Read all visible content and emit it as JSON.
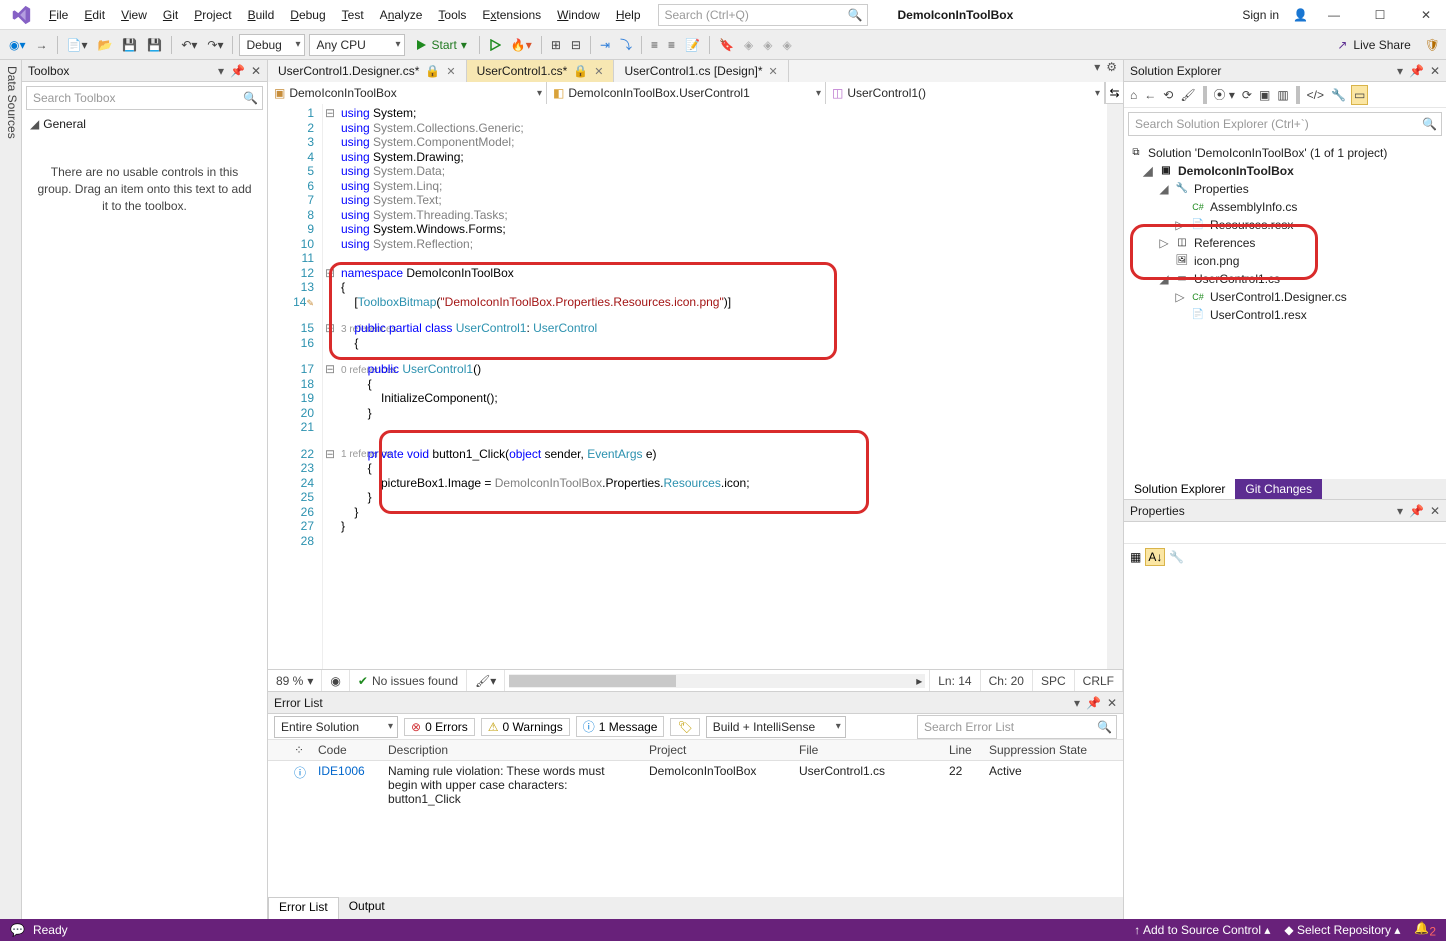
{
  "titlebar": {
    "menus": [
      "File",
      "Edit",
      "View",
      "Git",
      "Project",
      "Build",
      "Debug",
      "Test",
      "Analyze",
      "Tools",
      "Extensions",
      "Window",
      "Help"
    ],
    "menuKeys": [
      "F",
      "E",
      "V",
      "G",
      "P",
      "B",
      "D",
      "T",
      "n",
      "T",
      "x",
      "W",
      "H"
    ],
    "searchPlaceholder": "Search (Ctrl+Q)",
    "projectName": "DemoIconInToolBox",
    "signIn": "Sign in"
  },
  "toolbar": {
    "config": "Debug",
    "platform": "Any CPU",
    "start": "Start",
    "liveShare": "Live Share"
  },
  "leftRail": "Data Sources",
  "toolbox": {
    "title": "Toolbox",
    "searchPlaceholder": "Search Toolbox",
    "group": "General",
    "emptyMsg": "There are no usable controls in this group. Drag an item onto this text to add it to the toolbox."
  },
  "tabs": [
    {
      "label": "UserControl1.Designer.cs*",
      "active": false,
      "lock": true
    },
    {
      "label": "UserControl1.cs*",
      "active": true,
      "lock": true
    },
    {
      "label": "UserControl1.cs [Design]*",
      "active": false,
      "lock": false
    }
  ],
  "navbar": {
    "project": "DemoIconInToolBox",
    "class": "DemoIconInToolBox.UserControl1",
    "member": "UserControl1()"
  },
  "code": {
    "lines": [
      {
        "n": 1,
        "html": "<span class='kw'>using</span> System;"
      },
      {
        "n": 2,
        "html": "<span class='kw'>using</span> <span class='faded'>System.Collections.Generic;</span>"
      },
      {
        "n": 3,
        "html": "<span class='kw'>using</span> <span class='faded'>System.ComponentModel;</span>"
      },
      {
        "n": 4,
        "html": "<span class='kw'>using</span> System.Drawing;"
      },
      {
        "n": 5,
        "html": "<span class='kw'>using</span> <span class='faded'>System.Data;</span>"
      },
      {
        "n": 6,
        "html": "<span class='kw'>using</span> <span class='faded'>System.Linq;</span>"
      },
      {
        "n": 7,
        "html": "<span class='kw'>using</span> <span class='faded'>System.Text;</span>"
      },
      {
        "n": 8,
        "html": "<span class='kw'>using</span> <span class='faded'>System.Threading.Tasks;</span>"
      },
      {
        "n": 9,
        "html": "<span class='kw'>using</span> System.Windows.Forms;"
      },
      {
        "n": 10,
        "html": "<span class='kw'>using</span> <span class='faded'>System.Reflection;</span>"
      },
      {
        "n": 11,
        "html": ""
      },
      {
        "n": 12,
        "html": "<span class='kw'>namespace</span> DemoIconInToolBox"
      },
      {
        "n": 13,
        "html": "{"
      },
      {
        "n": "",
        "html": "    [<span class='typ'>ToolboxBitmap</span>(<span class='str'>\"DemoIconInToolBox.Properties.Resources.icon.png\"</span>)]",
        "pre14": true
      },
      {
        "n": "",
        "html": "     <span class='ref'>3 references</span>",
        "ref": true
      },
      {
        "n": 15,
        "html": "    <span class='kw'>public</span> <span class='kw'>partial</span> <span class='kw'>class</span> <span class='typ'>UserControl1</span>: <span class='typ'>UserControl</span>"
      },
      {
        "n": 16,
        "html": "    {"
      },
      {
        "n": "",
        "html": "         <span class='ref'>0 references</span>",
        "ref": true
      },
      {
        "n": 17,
        "html": "        <span class='kw'>public</span> <span class='typ'>UserControl1</span>()"
      },
      {
        "n": 18,
        "html": "        {"
      },
      {
        "n": 19,
        "html": "            InitializeComponent();"
      },
      {
        "n": 20,
        "html": "        }"
      },
      {
        "n": 21,
        "html": ""
      },
      {
        "n": "",
        "html": "         <span class='ref'>1 reference</span>",
        "ref": true
      },
      {
        "n": 22,
        "html": "        <span class='kw'>private</span> <span class='kw'>void</span> <span>button1_Click</span>(<span class='kw'>object</span> sender, <span class='typ'>EventArgs</span> e)"
      },
      {
        "n": 23,
        "html": "        {"
      },
      {
        "n": 24,
        "html": "            pictureBox1.Image = <span class='faded'>DemoIconInToolBox</span>.Properties.<span class='typ'>Resources</span>.icon;"
      },
      {
        "n": 25,
        "html": "        }"
      },
      {
        "n": 26,
        "html": "    }"
      },
      {
        "n": 27,
        "html": "}"
      },
      {
        "n": 28,
        "html": ""
      }
    ],
    "line14n": "14"
  },
  "editorStatus": {
    "zoom": "89 %",
    "issues": "No issues found",
    "ln": "Ln: 14",
    "ch": "Ch: 20",
    "ins": "SPC",
    "enc": "CRLF"
  },
  "errorList": {
    "title": "Error List",
    "scope": "Entire Solution",
    "errors": "0 Errors",
    "warnings": "0 Warnings",
    "messages": "1 Message",
    "build": "Build + IntelliSense",
    "searchPlaceholder": "Search Error List",
    "columns": [
      "",
      "",
      "Code",
      "Description",
      "Project",
      "File",
      "Line",
      "Suppression State"
    ],
    "rows": [
      {
        "icon": "info",
        "code": "IDE1006",
        "desc": "Naming rule violation: These words must begin with upper case characters: button1_Click",
        "project": "DemoIconInToolBox",
        "file": "UserControl1.cs",
        "line": "22",
        "state": "Active"
      }
    ],
    "bottomTabs": [
      "Error List",
      "Output"
    ]
  },
  "solution": {
    "title": "Solution Explorer",
    "searchPlaceholder": "Search Solution Explorer (Ctrl+`)",
    "root": "Solution 'DemoIconInToolBox' (1 of 1 project)",
    "nodes": [
      {
        "indent": 1,
        "exp": "◢",
        "icon": "csproj",
        "label": "DemoIconInToolBox",
        "bold": true
      },
      {
        "indent": 2,
        "exp": "◢",
        "icon": "wrench",
        "label": "Properties"
      },
      {
        "indent": 3,
        "exp": "",
        "icon": "cs",
        "label": "AssemblyInfo.cs"
      },
      {
        "indent": 3,
        "exp": "▷",
        "icon": "resx",
        "label": "Resources.resx"
      },
      {
        "indent": 2,
        "exp": "▷",
        "icon": "ref",
        "label": "References"
      },
      {
        "indent": 2,
        "exp": "",
        "icon": "img",
        "label": "icon.png"
      },
      {
        "indent": 2,
        "exp": "◢",
        "icon": "uc",
        "label": "UserControl1.cs"
      },
      {
        "indent": 3,
        "exp": "▷",
        "icon": "cs",
        "label": "UserControl1.Designer.cs"
      },
      {
        "indent": 3,
        "exp": "",
        "icon": "resx",
        "label": "UserControl1.resx"
      }
    ],
    "tabs": [
      "Solution Explorer",
      "Git Changes"
    ]
  },
  "properties": {
    "title": "Properties"
  },
  "statusbar": {
    "ready": "Ready",
    "addSource": "Add to Source Control",
    "selectRepo": "Select Repository",
    "notif": "2"
  }
}
